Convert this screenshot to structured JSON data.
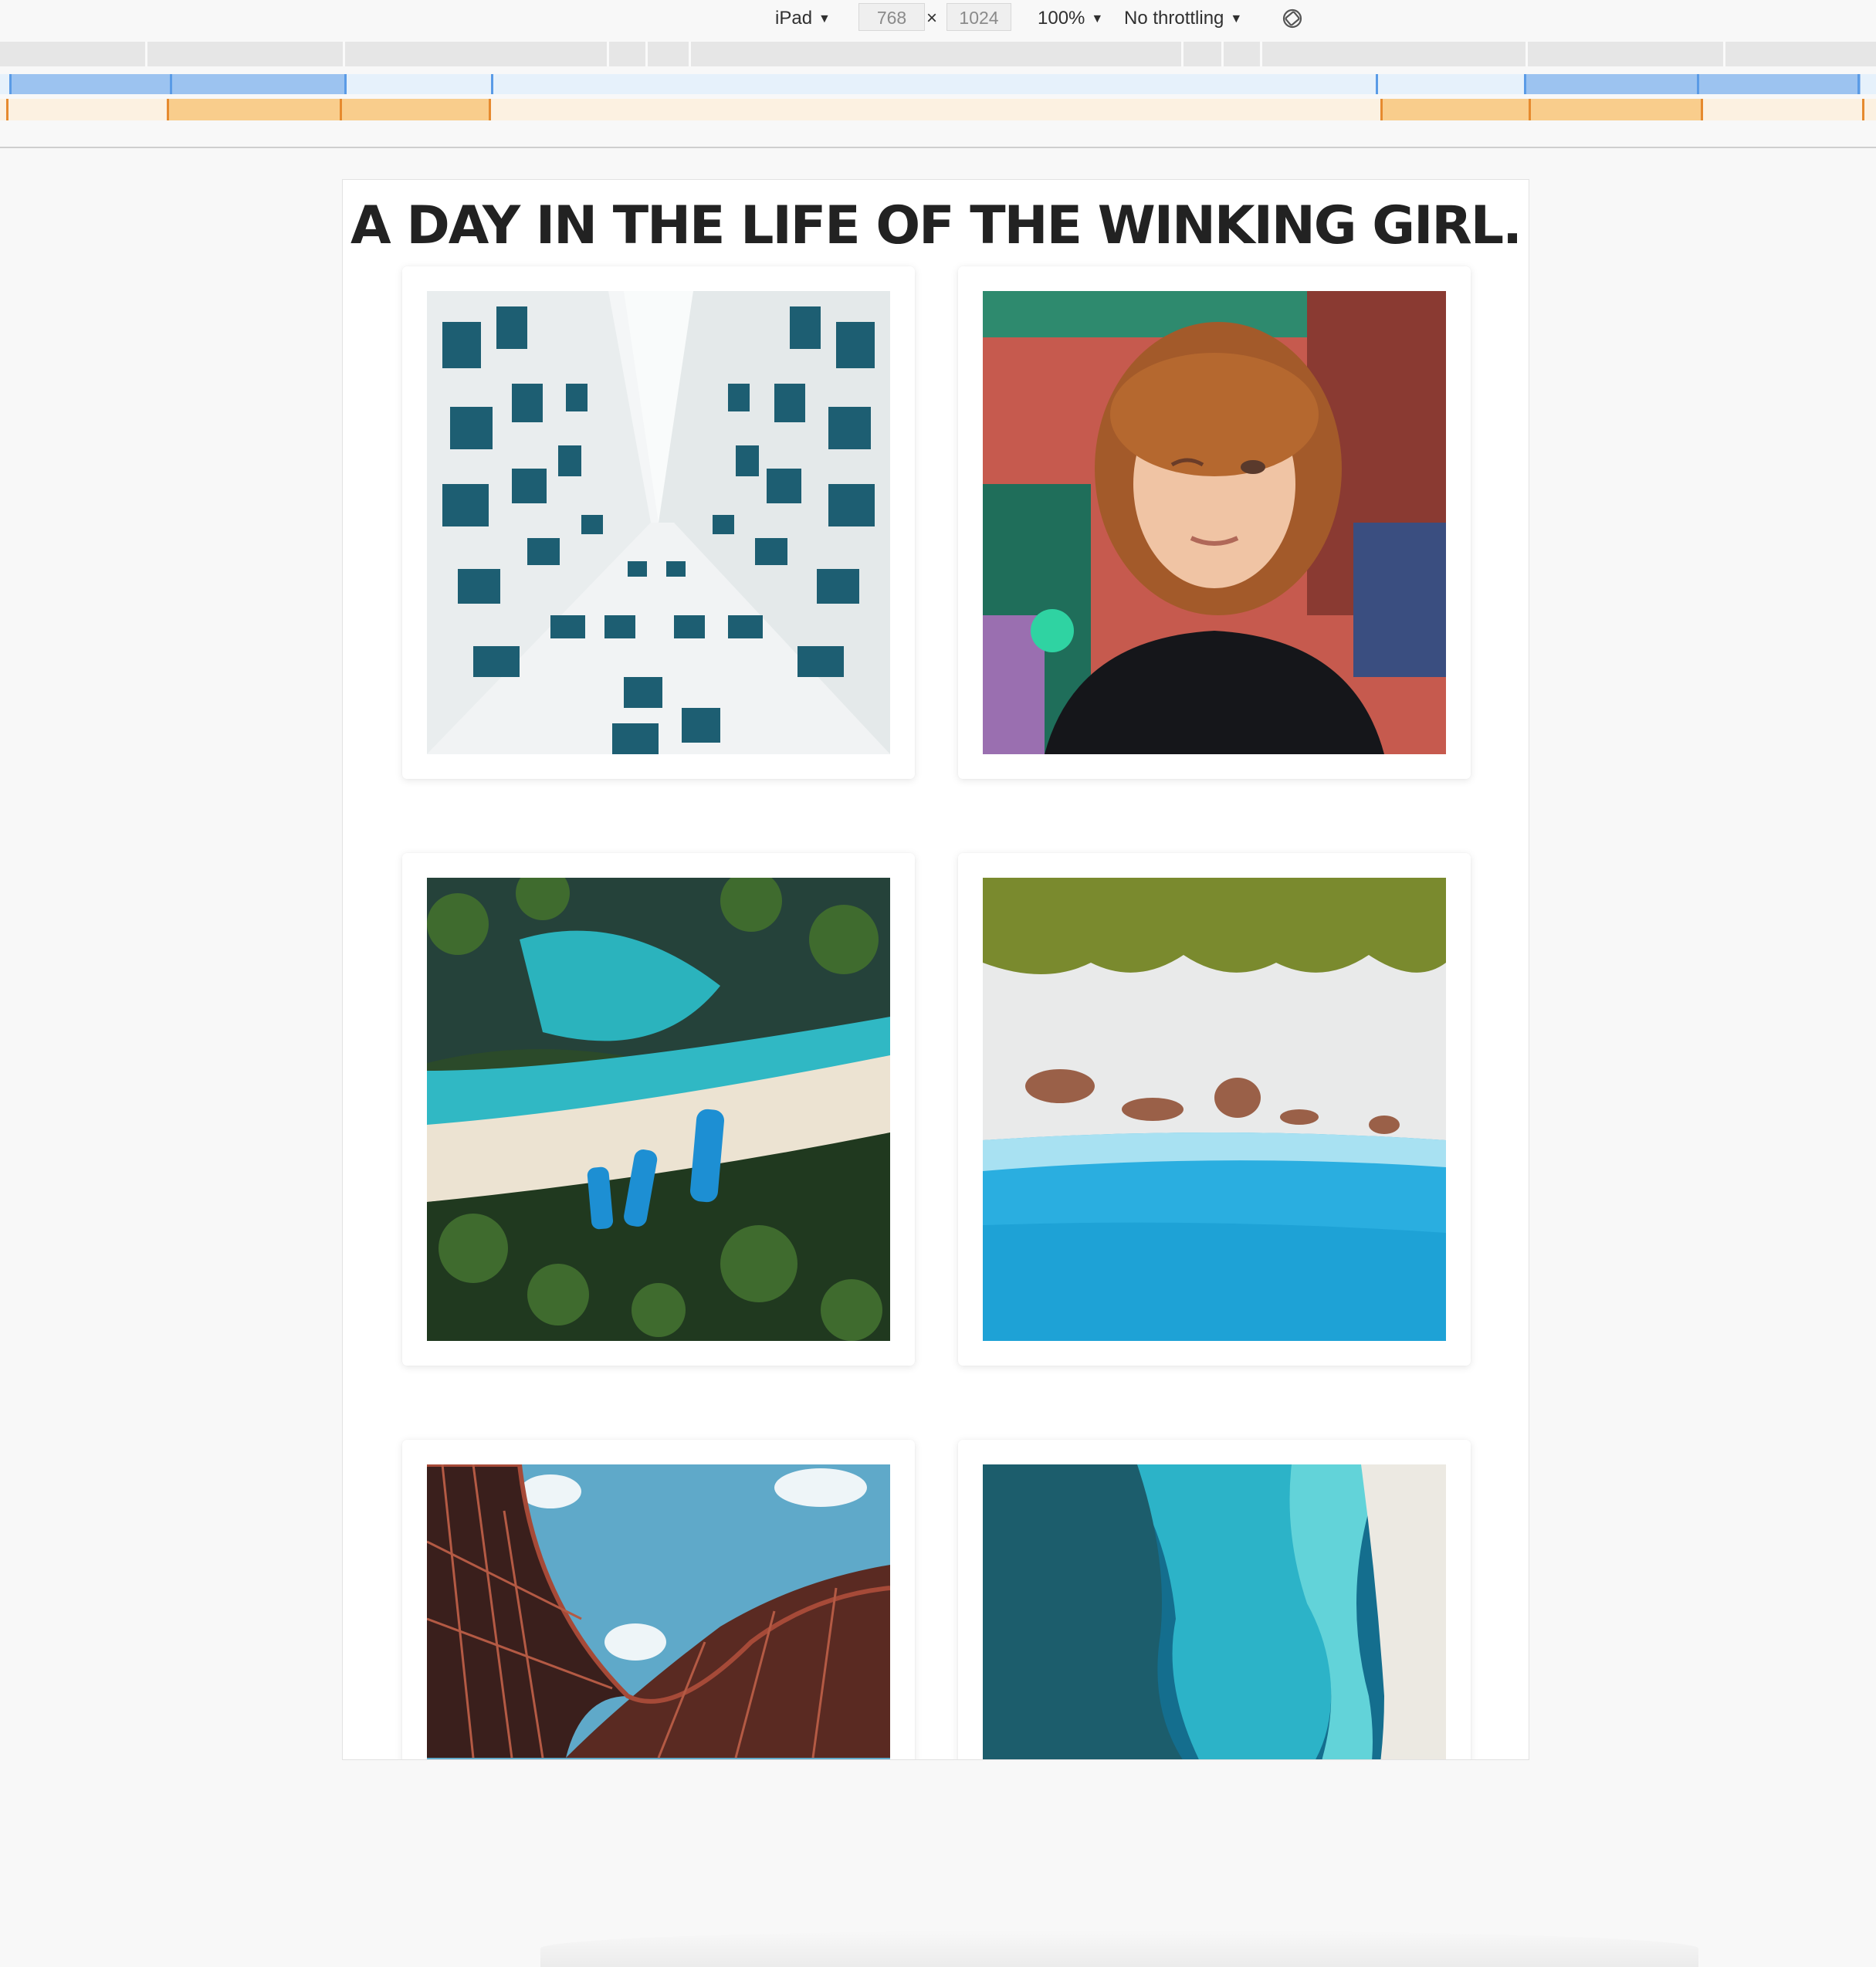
{
  "devtools": {
    "device": "iPad",
    "width": "768",
    "height": "1024",
    "separator": "×",
    "zoom": "100%",
    "throttling": "No throttling",
    "icons": {
      "dropdown": "caret-down-icon",
      "rotate": "rotate-icon"
    }
  },
  "page": {
    "title": "A DAY IN THE LIFE OF THE WINKING GIRL."
  },
  "gallery": {
    "photos": [
      "building-looking-up-photo",
      "winking-girl-portrait-photo",
      "tropical-beach-boats-aerial-photo",
      "beach-shoreline-aerial-photo",
      "curved-building-sky-photo",
      "ocean-rocks-aerial-photo"
    ]
  },
  "colors": {
    "accent_blue": "#5a9be6",
    "accent_orange": "#e68a2e",
    "title_text": "#222222"
  }
}
